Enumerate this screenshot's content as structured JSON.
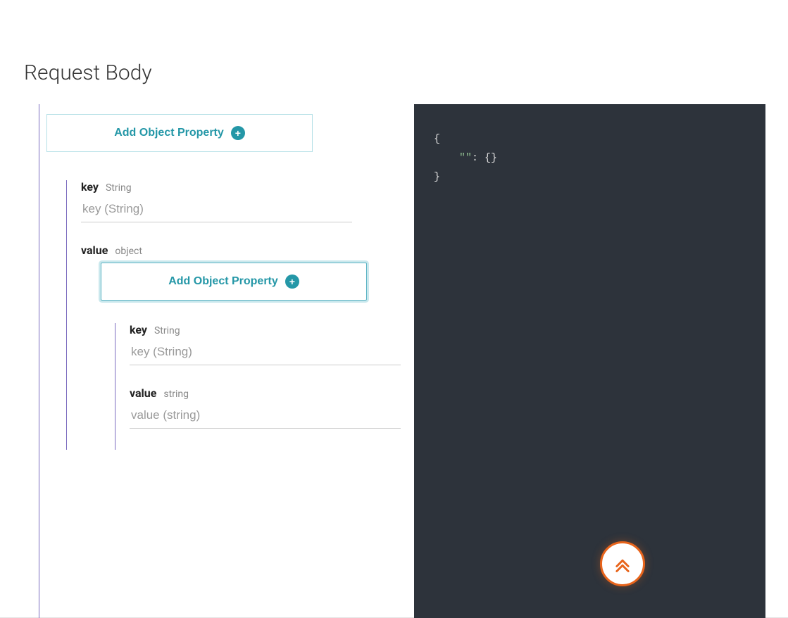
{
  "title": "Request Body",
  "outer": {
    "addButton": "Add Object Property",
    "prop": {
      "key": {
        "label": "key",
        "type": "String",
        "placeholder": "key (String)",
        "value": ""
      },
      "value": {
        "label": "value",
        "type": "object",
        "addButton": "Add Object Property",
        "prop": {
          "key": {
            "label": "key",
            "type": "String",
            "placeholder": "key (String)",
            "value": ""
          },
          "value": {
            "label": "value",
            "type": "string",
            "placeholder": "value (string)",
            "value": ""
          }
        }
      }
    }
  },
  "code": {
    "line1": "{",
    "keyQuoted": "\"\"",
    "afterKey": ": {}",
    "line3": "}"
  }
}
